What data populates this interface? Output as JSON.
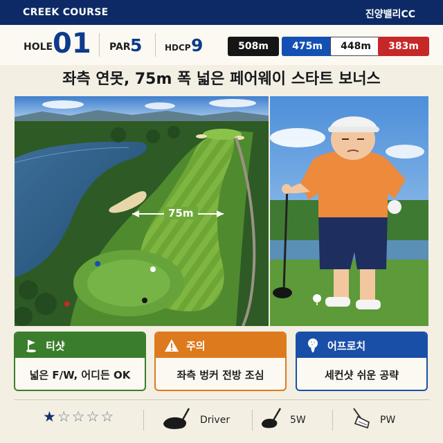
{
  "header": {
    "course_name": "CREEK COURSE",
    "club_name": "진양밸리CC"
  },
  "hole": {
    "hole_label": "HOLE",
    "hole_number": "01",
    "par_label": "PAR",
    "par_value": "5",
    "hdcp_label": "HDCP",
    "hdcp_value": "9"
  },
  "tees": [
    {
      "distance": "508m",
      "bg": "#151515",
      "fg": "#ffffff"
    },
    {
      "distance": "475m",
      "bg": "#1450b4",
      "fg": "#ffffff"
    },
    {
      "distance": "448m",
      "bg": "#ffffff",
      "fg": "#151515"
    },
    {
      "distance": "383m",
      "bg": "#c62828",
      "fg": "#ffffff"
    }
  ],
  "headline": "좌측 연못, 75m 폭 넓은 페어웨이 스타트 보너스",
  "course_map": {
    "fairway_width_label": "75m"
  },
  "tips": [
    {
      "title": "티샷",
      "text": "넓은 F/W, 어디든 OK",
      "color": "#3a7d2c",
      "icon": "flag-icon"
    },
    {
      "title": "주의",
      "text": "좌측 벙커 전방 조심",
      "color": "#de7a1e",
      "icon": "warning-icon"
    },
    {
      "title": "어프로치",
      "text": "세컨샷 쉬운 공략",
      "color": "#1a4fa8",
      "icon": "golf-ball-on-tee-icon"
    }
  ],
  "difficulty": {
    "rating": 1,
    "max": 5
  },
  "clubs": [
    {
      "label": "Driver",
      "icon": "driver-icon"
    },
    {
      "label": "5W",
      "icon": "fairway-wood-icon"
    },
    {
      "label": "PW",
      "icon": "iron-icon"
    }
  ]
}
